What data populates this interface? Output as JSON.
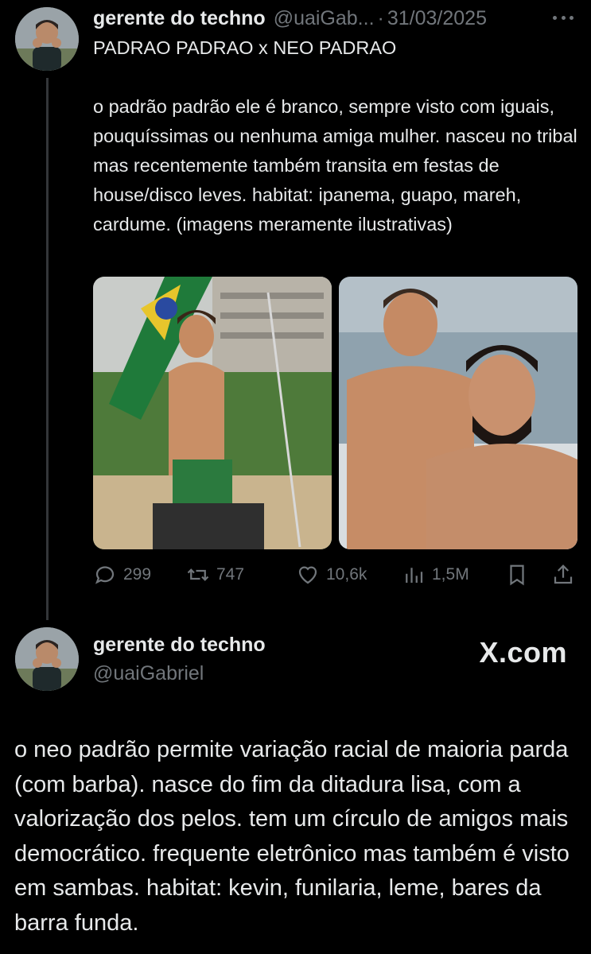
{
  "tweet1": {
    "author_name": "gerente do techno",
    "handle": "@uaiGab...",
    "separator": "·",
    "date": "31/03/2025",
    "text": "PADRAO PADRAO x NEO PADRAO\n\no padrão padrão ele é branco, sempre visto com iguais, pouquíssimas ou nenhuma amiga mulher. nasceu no tribal mas recentemente também transita em festas de house/disco leves. habitat: ipanema, guapo, mareh, cardume. (imagens meramente ilustrativas)",
    "more_icon": "more-horizontal-icon",
    "media": [
      {
        "name": "photo-man-beach-flag"
      },
      {
        "name": "photo-two-men-boat"
      }
    ],
    "actions": {
      "reply_count": "299",
      "retweet_count": "747",
      "like_count": "10,6k",
      "views_count": "1,5M"
    }
  },
  "tweet2": {
    "author_name": "gerente do techno",
    "handle": "@uaiGabriel",
    "watermark": "X.com",
    "text": "o neo padrão permite variação racial de maioria parda (com barba). nasce do fim da ditadura lisa, com a valorização dos pelos. tem um círculo de amigos mais democrático. frequente eletrônico mas também é visto em sambas. habitat: kevin, funilaria, leme, bares da barra funda."
  },
  "colors": {
    "background": "#000000",
    "text_primary": "#e7e9ea",
    "text_secondary": "#71767b",
    "thread_line": "#333639"
  }
}
